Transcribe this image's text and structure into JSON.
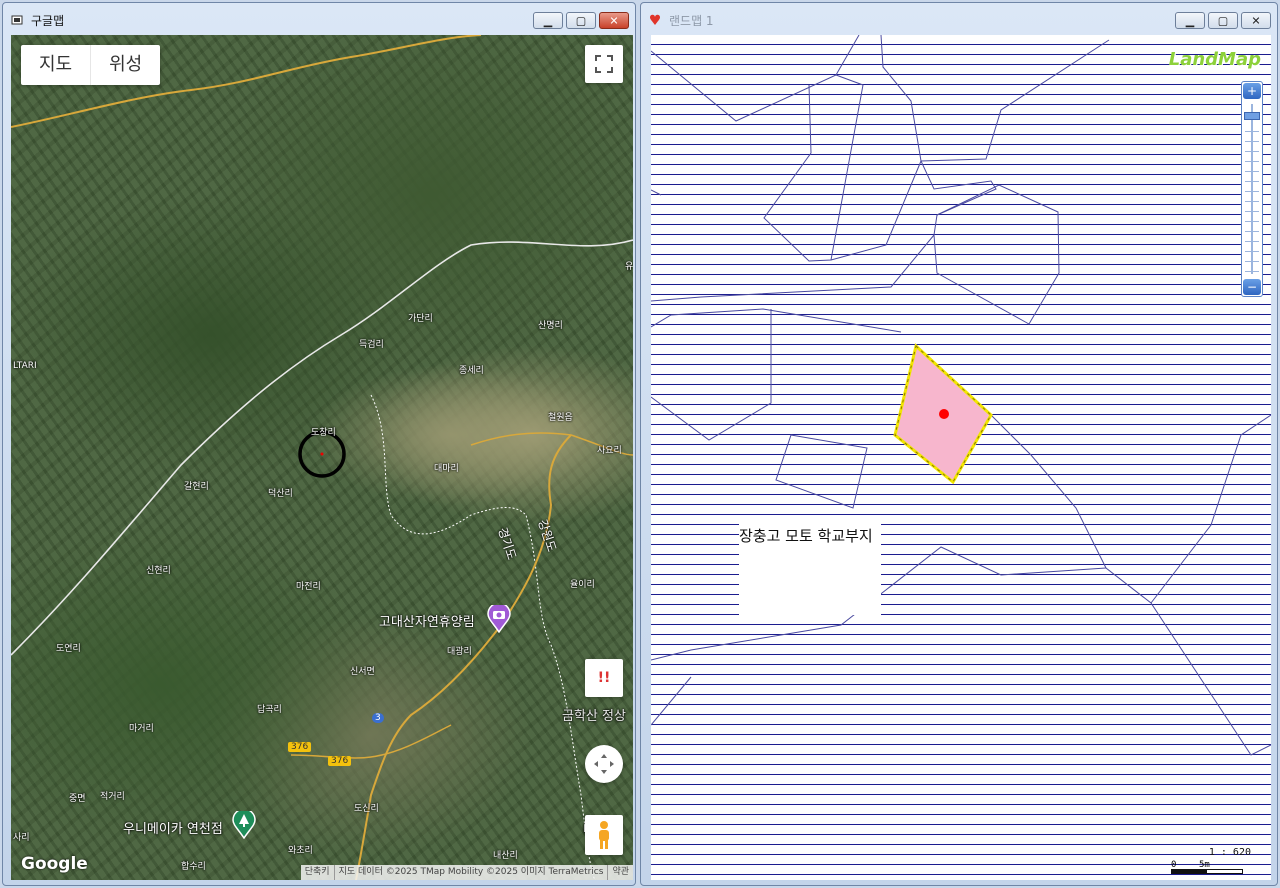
{
  "google_window": {
    "title": "구글맵",
    "map_type_buttons": [
      "지도",
      "위성"
    ],
    "place_labels": [
      "LTARI",
      "가단리",
      "산명리",
      "득검리",
      "종세리",
      "철원읍",
      "사요리",
      "도창리",
      "대마리",
      "갈현리",
      "덕산리",
      "신현리",
      "마전리",
      "율이리",
      "대광리",
      "신서면",
      "도연리",
      "답곡리",
      "마거리",
      "중면",
      "적거리",
      "도신리",
      "사리",
      "와초리",
      "합수리",
      "내산리",
      "유"
    ],
    "poi_labels": [
      "고대산자연휴양림",
      "우니메이카 연천점",
      "금학산 정상"
    ],
    "region_labels": [
      "경기도",
      "강원도"
    ],
    "road_numbers": [
      "376",
      "376",
      "3"
    ],
    "logo": "Google",
    "attribution": [
      "단축키",
      "지도 데이터 ©2025 TMap Mobility ©2025 이미지 TerraMetrics",
      "약관"
    ],
    "partial_label": "다",
    "report_label": "!!",
    "icons": [
      "fullscreen-icon",
      "map-compass-icon",
      "pegman-icon",
      "camera-pin-icon",
      "tree-pin-icon"
    ]
  },
  "land_window": {
    "title": "랜드맵 1",
    "logo": "LandMap",
    "parcel_label": "장충고 모토 학교부지",
    "scale_ratio": "1 : 620",
    "scale_ticks": [
      "0",
      "5m"
    ],
    "zoom_level": 0.05,
    "colors": {
      "hatch": "#1c1c8f",
      "boundary": "#4b4ba0",
      "selected_fill": "#f7b6cd",
      "selected_stroke": "#f2e600",
      "marker": "#ff0000"
    }
  }
}
